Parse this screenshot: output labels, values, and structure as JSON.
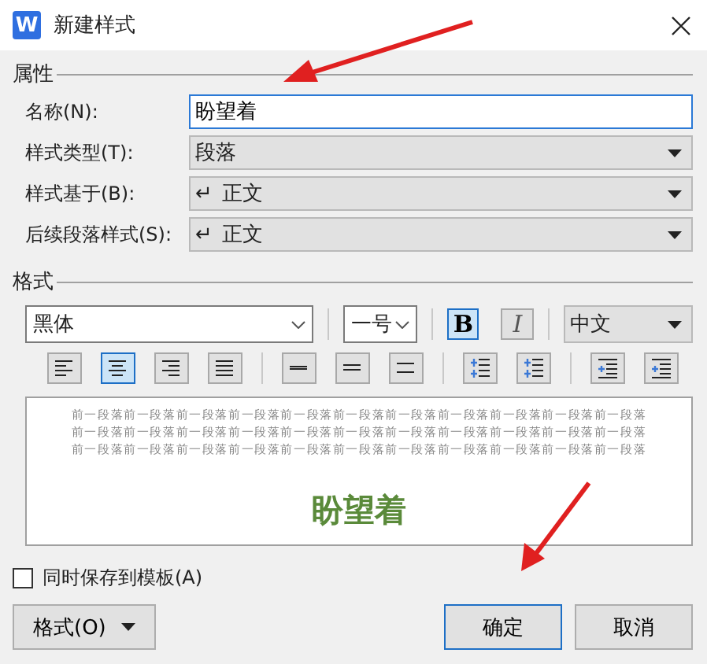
{
  "window": {
    "title": "新建样式",
    "app_badge": "W"
  },
  "properties": {
    "heading": "属性",
    "rows": [
      {
        "label": "名称(N):",
        "kind": "input",
        "value": "盼望着"
      },
      {
        "label": "样式类型(T):",
        "kind": "select",
        "value": "段落"
      },
      {
        "label": "样式基于(B):",
        "kind": "select",
        "value": "正文",
        "return_mark": "↵"
      },
      {
        "label": "后续段落样式(S):",
        "kind": "select",
        "value": "正文",
        "return_mark": "↵"
      }
    ]
  },
  "format": {
    "heading": "格式",
    "font": "黑体",
    "size": "一号",
    "bold": {
      "label": "B",
      "selected": true
    },
    "italic": {
      "label": "I",
      "selected": false
    },
    "script": "中文",
    "tool_groups": [
      [
        {
          "kind": "align-left",
          "selected": false
        },
        {
          "kind": "align-center",
          "selected": true
        },
        {
          "kind": "align-right",
          "selected": false
        },
        {
          "kind": "align-justify",
          "selected": false
        }
      ],
      [
        {
          "kind": "spacing-single",
          "selected": false
        },
        {
          "kind": "spacing-one-half",
          "selected": false
        },
        {
          "kind": "spacing-double",
          "selected": false
        }
      ],
      [
        {
          "kind": "para-space-before",
          "selected": false
        },
        {
          "kind": "para-space-after",
          "selected": false
        }
      ],
      [
        {
          "kind": "indent-decrease",
          "selected": false
        },
        {
          "kind": "indent-increase",
          "selected": false
        }
      ]
    ]
  },
  "preview": {
    "previous_lines": [
      "前一段落前一段落前一段落前一段落前一段落前一段落前一段落前一段落前一段落前一段落前一段落",
      "前一段落前一段落前一段落前一段落前一段落前一段落前一段落前一段落前一段落前一段落前一段落",
      "前一段落前一段落前一段落前一段落前一段落前一段落前一段落前一段落前一段落前一段落前一段落"
    ],
    "sample": "盼望着"
  },
  "save_to_template": {
    "label": "同时保存到模板(A)",
    "checked": false
  },
  "buttons": {
    "format": "格式(O)",
    "ok": "确定",
    "cancel": "取消"
  }
}
